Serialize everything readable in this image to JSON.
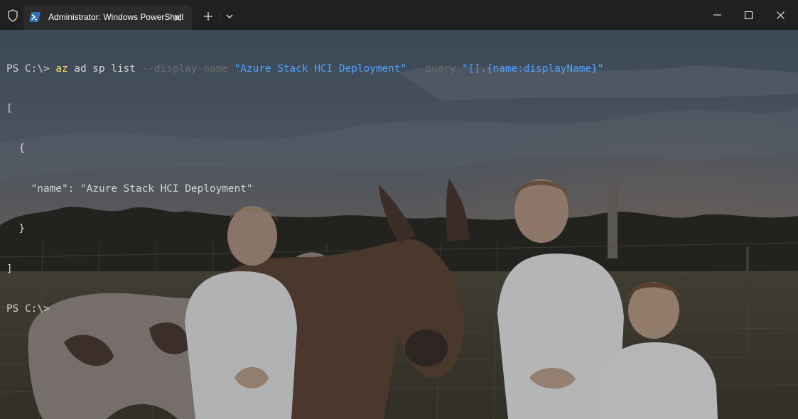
{
  "window": {
    "tab_title": "Administrator: Windows PowerShell",
    "icons": {
      "shield": "shield-icon",
      "tab": "powershell-icon",
      "tab_close": "close-icon",
      "new_tab": "plus-icon",
      "dropdown": "chevron-down-icon",
      "minimize": "minimize-icon",
      "maximize": "maximize-icon",
      "close": "close-icon"
    }
  },
  "terminal": {
    "line1": {
      "prompt": "PS C:\\> ",
      "command": "az",
      "args": " ad sp list ",
      "param1": "--display-name",
      "value1": "\"Azure Stack HCI Deployment\"",
      "param2": "--query",
      "value2": "\"[].{name:displayName}\""
    },
    "line2": "[",
    "line3": "  {",
    "line4": "    \"name\": \"Azure Stack HCI Deployment\"",
    "line5": "  }",
    "line6": "]",
    "line7": "PS C:\\>"
  },
  "colors": {
    "command": "#f5e26b",
    "parameter": "#6c6c6c",
    "string": "#4fa3ff",
    "text": "#d4d4d4",
    "titlebar": "#202020"
  }
}
